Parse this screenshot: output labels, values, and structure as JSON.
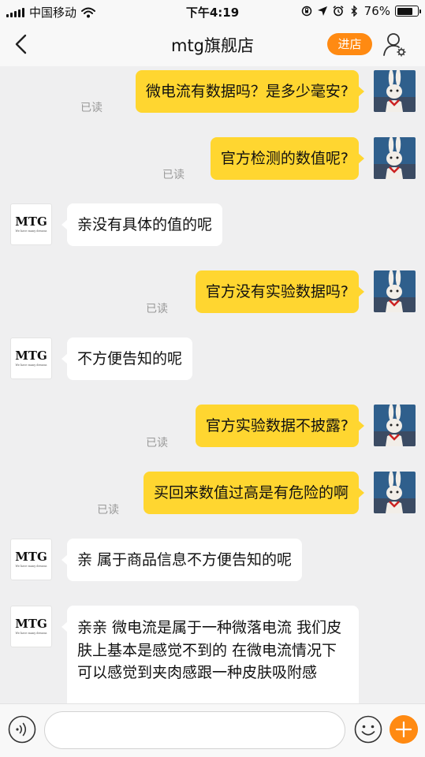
{
  "status_bar": {
    "carrier": "中国移动",
    "time": "下午4:19",
    "battery": "76%",
    "battery_level": 0.76
  },
  "nav": {
    "title": "mtg旗舰店",
    "enter_store": "进店"
  },
  "read_label": "已读",
  "store_logo": {
    "word": "MTG",
    "tagline": "We have many dreams"
  },
  "messages": [
    {
      "side": "right",
      "text": "微电流有数据吗？是多少毫安?",
      "read": "已读"
    },
    {
      "side": "right",
      "text": "官方检测的数值呢?",
      "read": "已读"
    },
    {
      "side": "left",
      "text": "亲没有具体的值的呢"
    },
    {
      "side": "right",
      "text": "官方没有实验数据吗?",
      "read": "已读"
    },
    {
      "side": "left",
      "text": "不方便告知的呢"
    },
    {
      "side": "right",
      "text": "官方实验数据不披露?",
      "read": "已读"
    },
    {
      "side": "right",
      "text": "买回来数值过高是有危险的啊",
      "read": "已读"
    },
    {
      "side": "left",
      "text": "亲 属于商品信息不方便告知的呢"
    },
    {
      "side": "left",
      "text": "亲亲 微电流是属于一种微落电流 我们皮肤上基本是感觉不到的 在微电流情况下可以感觉到夹肉感跟一种皮肤吸附感"
    }
  ],
  "input": {
    "value": "",
    "placeholder": ""
  },
  "icons": {
    "back": "chevron-left-icon",
    "profile": "user-settings-icon",
    "voice": "voice-icon",
    "emoji": "emoji-icon",
    "plus": "plus-icon"
  },
  "colors": {
    "accent": "#ff8a12",
    "bubble_self": "#ffd630",
    "bubble_other": "#ffffff",
    "background": "#efeff0"
  }
}
